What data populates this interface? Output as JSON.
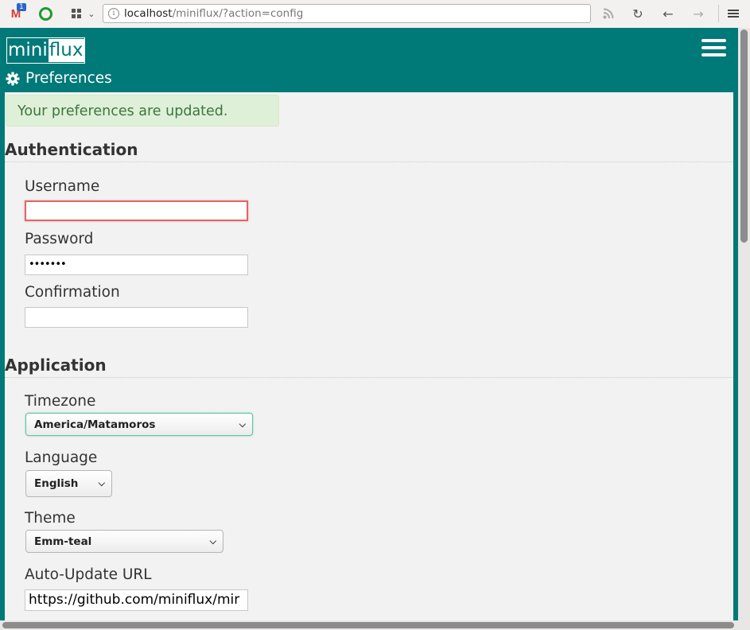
{
  "browser": {
    "gmail_badge": "1",
    "url_host": "localhost",
    "url_path": "/miniflux/?action=config"
  },
  "header": {
    "logo_part1": "mini",
    "logo_part2": "flux",
    "page_title": "Preferences"
  },
  "alert": {
    "message": "Your preferences are updated."
  },
  "auth": {
    "heading": "Authentication",
    "username_label": "Username",
    "username_value": "",
    "password_label": "Password",
    "password_value": "•••••••",
    "confirmation_label": "Confirmation",
    "confirmation_value": ""
  },
  "application": {
    "heading": "Application",
    "timezone_label": "Timezone",
    "timezone_value": "America/Matamoros",
    "language_label": "Language",
    "language_value": "English",
    "theme_label": "Theme",
    "theme_value": "Emm-teal",
    "autoupdate_label": "Auto-Update URL",
    "autoupdate_value": "https://github.com/miniflux/mir"
  },
  "colors": {
    "brand_teal": "#007979",
    "alert_green_bg": "#dff0d8",
    "alert_green_text": "#3c763d",
    "error_red": "#e06666"
  }
}
